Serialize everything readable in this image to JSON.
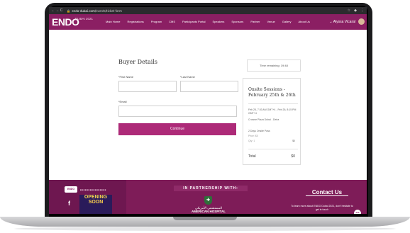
{
  "browser": {
    "url_prefix": "endo-dubai.com/",
    "url_path": "events/ticket-form",
    "nav_controls": "← → C"
  },
  "site": {
    "logo": "ENDO",
    "logo_sub": "DUBAI 2021",
    "menu": [
      "Main Home",
      "Registrations",
      "Program",
      "CMS",
      "Participants Portal",
      "Speakers",
      "Sponsors",
      "Partner",
      "Venue",
      "Gallery",
      "About Us"
    ],
    "user_name": "Alyssa Vicaral"
  },
  "form": {
    "title": "Buyer Details",
    "first_name_label": "*First Name",
    "last_name_label": "*Last Name",
    "email_label": "*Email",
    "continue_label": "Continue"
  },
  "summary": {
    "timer": "Time remaining: 19:48",
    "session_title": "Onsite Sessions - February 25th & 26th",
    "dates": "Feb 25, 7:30 AM GMT+4 - Feb 26, 8:15 PM GMT+4",
    "venue": "Crowne Plaza Dubai - Deira",
    "ticket_name": "2 Days Onsite Pass",
    "ticket_price": "Price: $0",
    "ticket_qty": "Qty: 1",
    "ticket_amount": "$0",
    "total_label": "Total",
    "total_value": "$0"
  },
  "footer": {
    "partnership_title": "IN PARTNERSHIP WITH:",
    "partner_arabic": "المستشفى الأمريكي",
    "partner_english": "AMERICAN HOSPITAL",
    "promo_text": "OPENING SOON",
    "contact_title": "Contact Us",
    "contact_text": "To learn more about ENDO Dubai 2021, don't hesitate to get in touch"
  },
  "colors": {
    "brand": "#8b1f63",
    "button": "#ad2a78",
    "footer": "#7e1c58"
  }
}
